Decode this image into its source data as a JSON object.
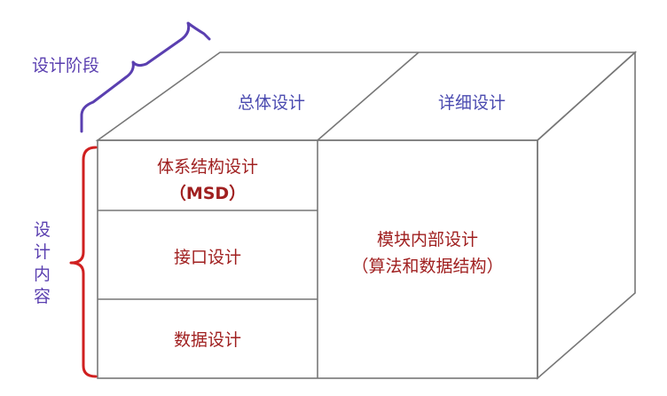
{
  "stage_bracket": {
    "label": "设计阶段",
    "color": "#5a3fb0"
  },
  "content_bracket": {
    "label_chars": [
      "设",
      "计",
      "内",
      "容"
    ],
    "color": "#d02020"
  },
  "phases": {
    "overall": "总体设计",
    "detailed": "详细设计"
  },
  "front_cells": {
    "architecture": {
      "line1": "体系结构设计",
      "line2": "（MSD）"
    },
    "interface": "接口设计",
    "data": "数据设计"
  },
  "module_cell": {
    "line1": "模块内部设计",
    "line2": "（算法和数据结构）"
  },
  "colors": {
    "box_edge": "#777777",
    "content_text": "#a02020",
    "phase_text": "#4b4bb0"
  }
}
